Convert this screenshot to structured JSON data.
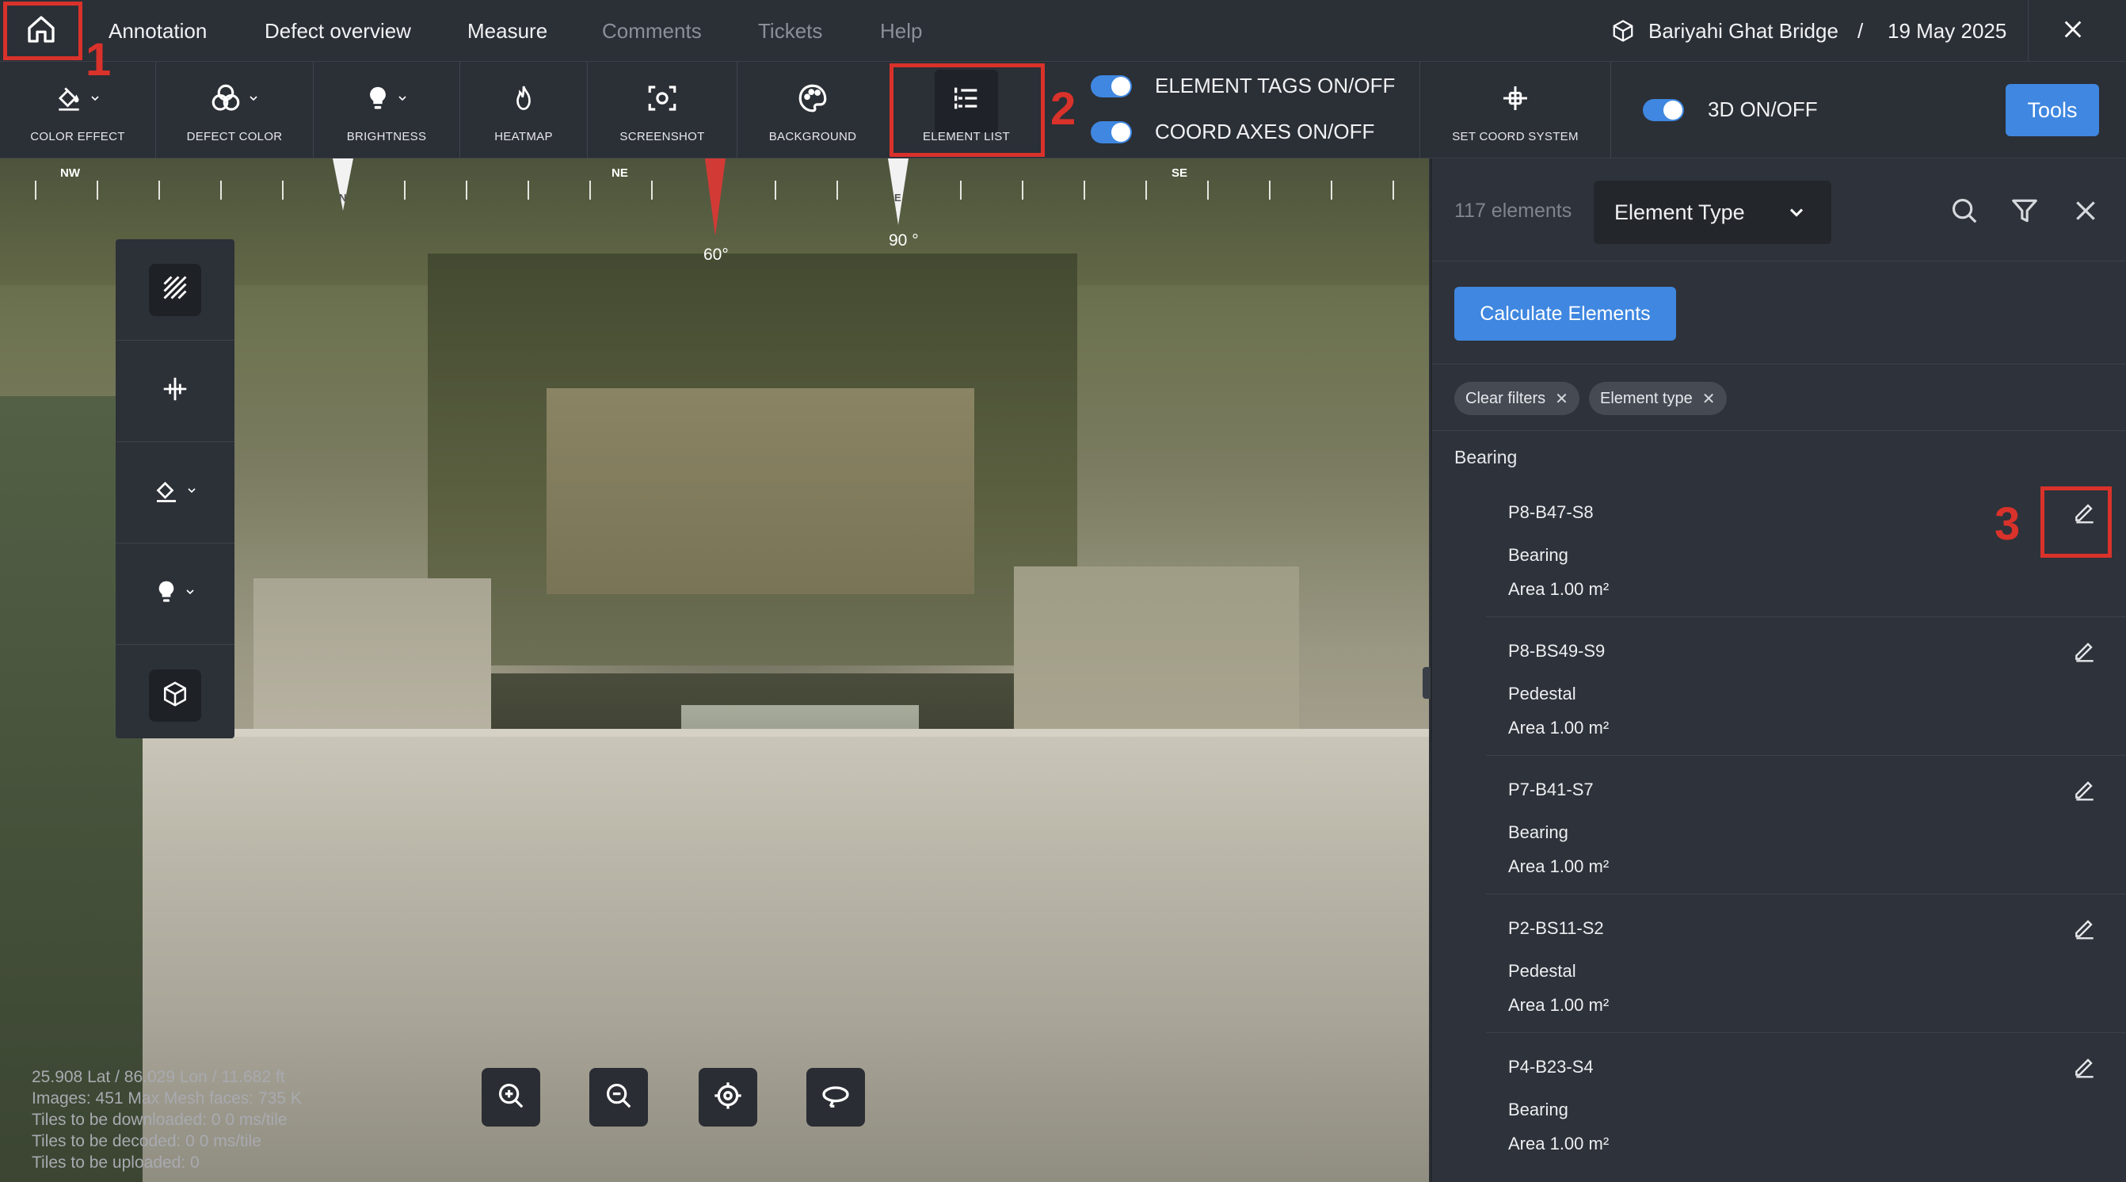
{
  "nav": {
    "items": [
      {
        "label": "Annotation",
        "dim": false
      },
      {
        "label": "Defect overview",
        "dim": false
      },
      {
        "label": "Measure",
        "dim": false
      },
      {
        "label": "Comments",
        "dim": true
      },
      {
        "label": "Tickets",
        "dim": true
      },
      {
        "label": "Help",
        "dim": true
      }
    ],
    "project_name": "Bariyahi Ghat Bridge",
    "separator": "/",
    "date": "19 May 2025"
  },
  "toolbar": {
    "tools": [
      {
        "label": "COLOR EFFECT",
        "icon": "paint-bucket-icon"
      },
      {
        "label": "DEFECT COLOR",
        "icon": "color-circles-icon"
      },
      {
        "label": "BRIGHTNESS",
        "icon": "bulb-icon"
      },
      {
        "label": "HEATMAP",
        "icon": "flame-icon"
      },
      {
        "label": "SCREENSHOT",
        "icon": "camera-focus-icon"
      },
      {
        "label": "BACKGROUND",
        "icon": "palette-icon"
      },
      {
        "label": "ELEMENT LIST",
        "icon": "list-icon"
      }
    ],
    "element_tags_label": "ELEMENT TAGS ON/OFF",
    "coord_axes_label": "COORD AXES ON/OFF",
    "set_coord_label": "SET COORD SYSTEM",
    "threed_label": "3D ON/OFF",
    "tools_button": "Tools",
    "toggles": {
      "element_tags": true,
      "coord_axes": true,
      "threed": true
    }
  },
  "compass": {
    "directions": [
      "NW",
      "NE",
      "SE"
    ],
    "needles": [
      {
        "letter": "N",
        "degree": ""
      },
      {
        "letter": "",
        "degree": "60°"
      },
      {
        "letter": "E",
        "degree": "90 °"
      }
    ]
  },
  "stats": {
    "lines": [
      "25.908 Lat / 86.029 Lon / 11.682 ft",
      "Images: 451 Max    Mesh faces: 735 K",
      "Tiles to be downloaded: 0    0 ms/tile",
      "Tiles to be decoded: 0    0 ms/tile",
      "Tiles to be uploaded: 0"
    ]
  },
  "right_panel": {
    "count": "117 elements",
    "select_value": "Element Type",
    "calculate_button": "Calculate Elements",
    "chips": [
      "Clear filters",
      "Element type"
    ],
    "group_title": "Bearing",
    "elements": [
      {
        "id": "P8-B47-S8",
        "type": "Bearing",
        "area": "Area 1.00 m²"
      },
      {
        "id": "P8-BS49-S9",
        "type": "Pedestal",
        "area": "Area 1.00 m²"
      },
      {
        "id": "P7-B41-S7",
        "type": "Bearing",
        "area": "Area 1.00 m²"
      },
      {
        "id": "P2-BS11-S2",
        "type": "Pedestal",
        "area": "Area 1.00 m²"
      },
      {
        "id": "P4-B23-S4",
        "type": "Bearing",
        "area": "Area 1.00 m²"
      }
    ]
  },
  "annotations": [
    "1",
    "2",
    "3"
  ],
  "colors": {
    "accent": "#3f87e0",
    "annotation_red": "#d9322b",
    "panel_bg": "#2e323a",
    "bar_bg": "#2b2f36"
  }
}
